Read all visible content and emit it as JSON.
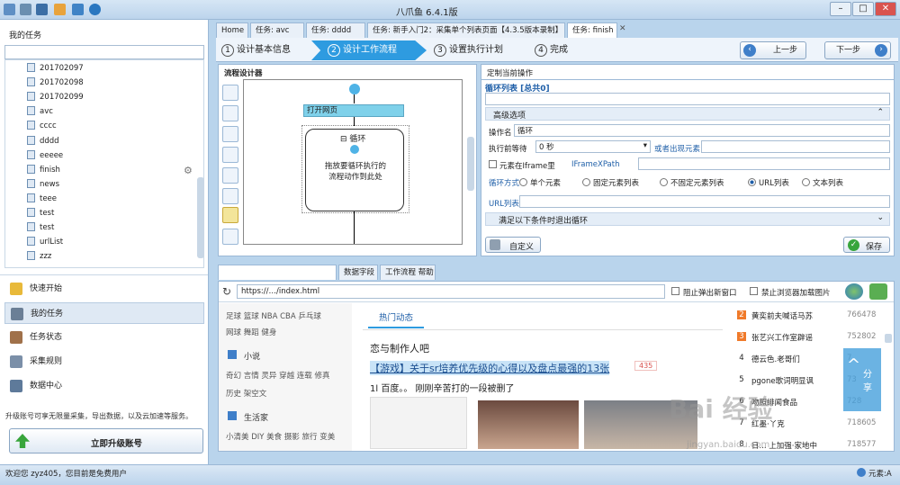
{
  "window": {
    "title": "八爪鱼 6.4.1版"
  },
  "left": {
    "header": "我的任务",
    "tree": [
      "201702097",
      "201702098",
      "201702099",
      "avc",
      "cccc",
      "dddd",
      "eeeee",
      "finish",
      "news",
      "teee",
      "test",
      "test",
      "urlList",
      "zzz"
    ],
    "nav": [
      "快速开始",
      "我的任务",
      "任务状态",
      "采集规则",
      "数据中心"
    ],
    "upgrade_text": "升级账号可享无限量采集，导出数据，以及云加速等服务。",
    "upgrade_button": "立即升级账号"
  },
  "tabs": [
    "Home",
    "任务: avc",
    "任务: dddd",
    "任务: 新手入门2：采集单个列表页面【4.3.5版本录制】",
    "任务: finish"
  ],
  "steps": [
    "设计基本信息",
    "设计工作流程",
    "设置执行计划",
    "完成"
  ],
  "step_nums": [
    "1",
    "2",
    "3",
    "4"
  ],
  "nav_buttons": {
    "prev": "上一步",
    "next": "下一步"
  },
  "designer": {
    "title": "流程设计器",
    "open_page": "打开网页",
    "loop_label": "循环",
    "drop_hint": "拖放要循环执行的流程动作到此处"
  },
  "props": {
    "title": "定制当前操作",
    "loop_list": "循环列表 [总共0]",
    "advanced": "高级选项",
    "op_name_label": "操作名",
    "op_name_value": "循环",
    "wait_label": "执行前等待",
    "wait_value": "0 秒",
    "or_appear": "或者出现元素",
    "iframe_label": "元素在Iframe里",
    "iframe_xpath": "IFrameXPath",
    "loop_mode_label": "循环方式",
    "loop_modes": [
      "单个元素",
      "固定元素列表",
      "不固定元素列表",
      "URL列表",
      "文本列表"
    ],
    "url_list_label": "URL列表",
    "exit_cond": "满足以下条件时退出循环",
    "custom_btn": "自定义",
    "save_btn": "保存"
  },
  "bottom_tabs": [
    "数据字段",
    "工作流程 帮助"
  ],
  "browser": {
    "url": "https://…/index.html",
    "block_popup": "阻止弹出新窗口",
    "block_images": "禁止浏览器加载图片",
    "cats": [
      "足球 篮球 NBA CBA 乒乓球",
      "网球 舞蹈 健身"
    ],
    "novel_title": "小说",
    "novel_cats": [
      "奇幻 言情 灵异 穿越 连载 修真",
      "历史 架空文"
    ],
    "life_title": "生活家",
    "life_cats": "小清美 DIY 美食 摄影 旅行 变美",
    "hot_tab": "热门动态",
    "headline": "恋与制作人吧",
    "link": "【游戏】关于sr培养优先级的心得以及盘点最强的13张",
    "link_count": "435",
    "snippet": "1l 百度。。 刚刚辛苦打的一段被删了",
    "hot_list": [
      {
        "n": "2",
        "t": "黄奕前夫喊话马苏",
        "v": "766478"
      },
      {
        "n": "3",
        "t": "张艺兴工作室辟谣",
        "v": "752802"
      },
      {
        "n": "4",
        "t": "德云色.老哥们",
        "v": "7"
      },
      {
        "n": "5",
        "t": "pgone歌词明显讽",
        "v": "73"
      },
      {
        "n": "6",
        "t": "吻照绯闻食品",
        "v": "728"
      },
      {
        "n": "7",
        "t": "红墨·丫克",
        "v": "718605"
      },
      {
        "n": "8",
        "t": "日... 上加强·家地中",
        "v": "718577"
      }
    ],
    "share": "分享"
  },
  "status": {
    "left": "欢迎您 zyz405，您目前是免费用户",
    "right": "元素:A"
  },
  "watermark": {
    "logo": "Bai 经验",
    "url": "jingyan.baidu.com"
  },
  "colors": {
    "accent": "#1f8fd6",
    "step_active": "#2e9be0",
    "open_page_bg": "#7fd1ea"
  }
}
